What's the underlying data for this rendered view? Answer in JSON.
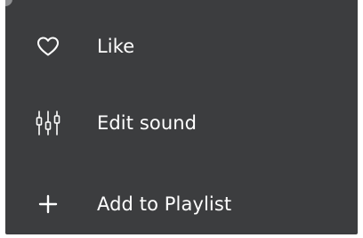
{
  "menu": {
    "items": [
      {
        "label": "Like",
        "icon": "heart-icon"
      },
      {
        "label": "Edit sound",
        "icon": "equalizer-icon"
      },
      {
        "label": "Add to Playlist",
        "icon": "plus-icon"
      }
    ]
  },
  "colors": {
    "menu_background": "#3c3d3f",
    "text": "#ffffff",
    "page_background": "#ffffff"
  }
}
